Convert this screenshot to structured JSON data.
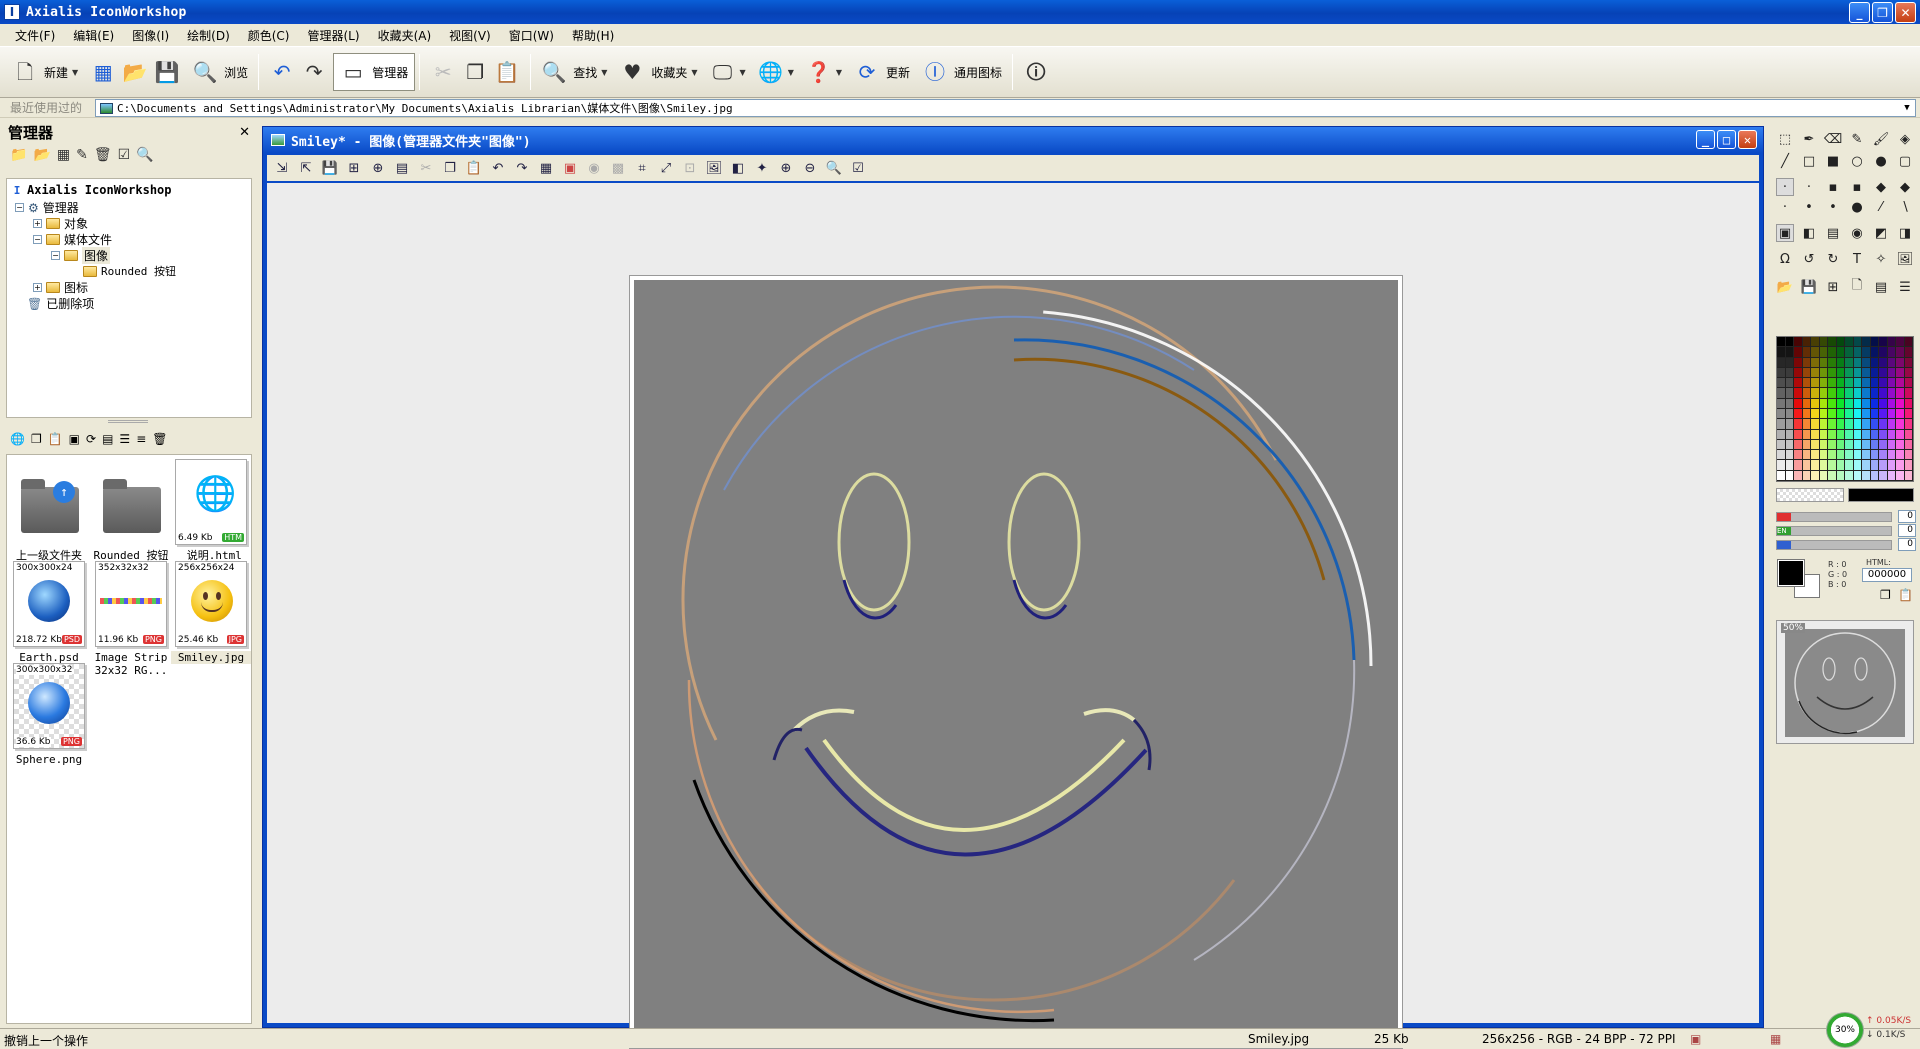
{
  "app": {
    "title": "Axialis IconWorkshop"
  },
  "menu": [
    "文件(F)",
    "编辑(E)",
    "图像(I)",
    "绘制(D)",
    "颜色(C)",
    "管理器(L)",
    "收藏夹(A)",
    "视图(V)",
    "窗口(W)",
    "帮助(H)"
  ],
  "toolbar": {
    "new_label": "新建",
    "browse_label": "浏览",
    "manager_label": "管理器",
    "search_label": "查找",
    "favorites_label": "收藏夹",
    "update_label": "更新",
    "universal_icon_label": "通用图标"
  },
  "address": {
    "label": "最近使用过的",
    "path": "C:\\Documents and Settings\\Administrator\\My Documents\\Axialis Librarian\\媒体文件\\图像\\Smiley.jpg"
  },
  "manager": {
    "title": "管理器",
    "close": "✕",
    "tree": {
      "root": "Axialis IconWorkshop",
      "manager": "管理器",
      "objects": "对象",
      "media": "媒体文件",
      "images": "图像",
      "rounded": "Rounded 按钮",
      "icons": "图标",
      "deleted": "已删除项"
    },
    "files": [
      {
        "name": "上一级文件夹"
      },
      {
        "name": "Rounded 按钮"
      },
      {
        "name": "_说明.html",
        "size": "6.49 Kb",
        "badge": "HTM"
      },
      {
        "name": "Earth.psd",
        "dims": "300x300x24",
        "size": "218.72 Kb",
        "badge": "PSD"
      },
      {
        "name": "Image Strip 32x32 RG...",
        "dims": "352x32x32",
        "size": "11.96 Kb",
        "badge": "PNG"
      },
      {
        "name": "Smiley.jpg",
        "dims": "256x256x24",
        "size": "25.46 Kb",
        "badge": "JPG"
      },
      {
        "name": "Sphere.png",
        "dims": "300x300x32",
        "size": "36.6 Kb",
        "badge": "PNG"
      }
    ]
  },
  "document": {
    "title": "Smiley* - 图像(管理器文件夹\"图像\")"
  },
  "colors": {
    "sliders": [
      {
        "label": "",
        "value": "0",
        "color": "#e03030",
        "fraction": 0.12
      },
      {
        "label": "EN",
        "value": "0",
        "color": "#30a030",
        "fraction": 0.12
      },
      {
        "label": "",
        "value": "0",
        "color": "#3060d0",
        "fraction": 0.12
      }
    ],
    "rgb": "R : 0\nG : 0\nB : 0",
    "html_label": "HTML:",
    "hex": "000000"
  },
  "preview": {
    "zoom": "50%"
  },
  "status": {
    "message": "撤销上一个操作",
    "file": "Smiley.jpg",
    "size": "25 Kb",
    "info": "256x256 - RGB - 24 BPP - 72 PPI",
    "net_pct": "30%",
    "up": "↑ 0.05K/S",
    "down": "↓ 0.1K/S"
  }
}
